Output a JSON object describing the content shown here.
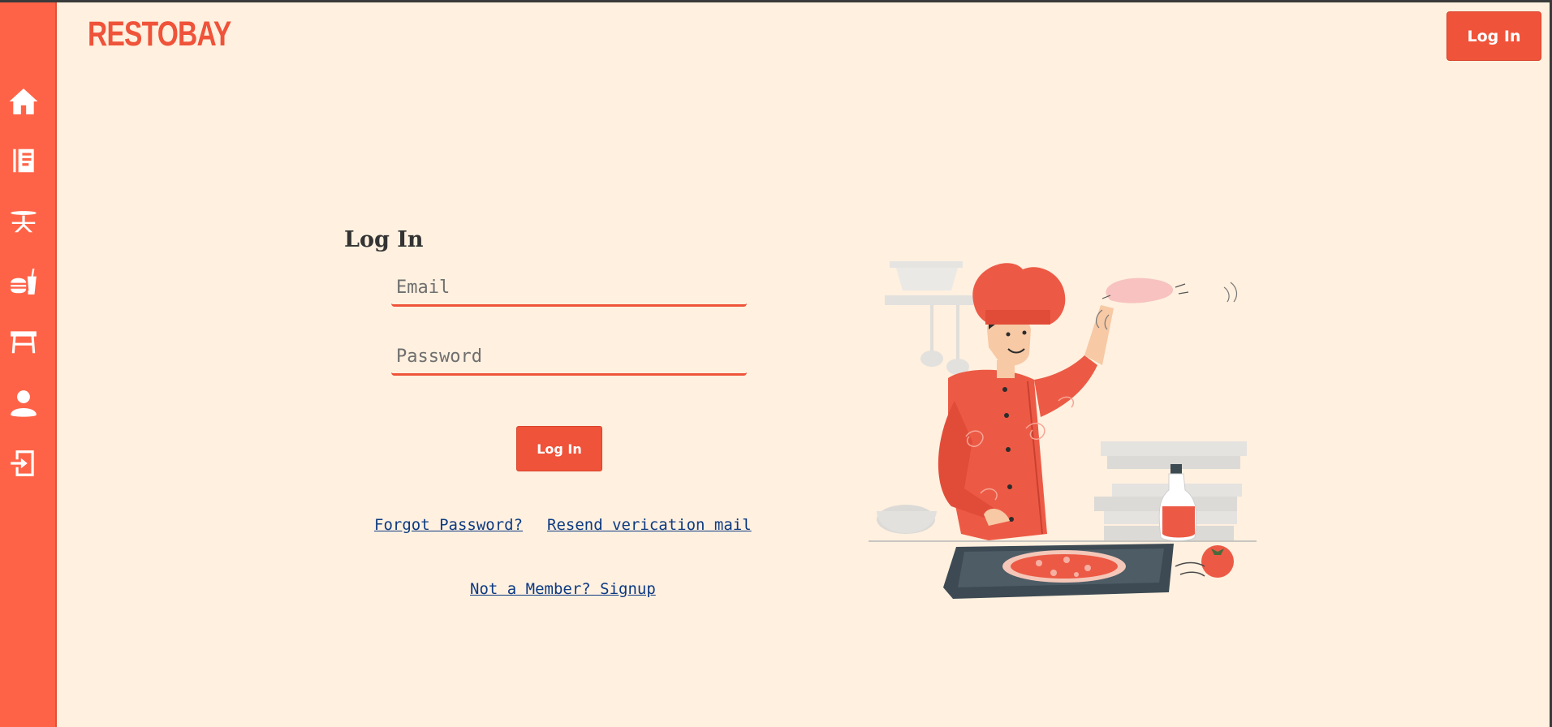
{
  "brand": {
    "name": "RESTOBAY"
  },
  "header": {
    "login_label": "Log In"
  },
  "sidebar": {
    "items": [
      {
        "icon": "home-icon"
      },
      {
        "icon": "menu-book-icon"
      },
      {
        "icon": "table-icon"
      },
      {
        "icon": "food-icon"
      },
      {
        "icon": "bench-icon"
      },
      {
        "icon": "user-icon"
      },
      {
        "icon": "sign-in-icon"
      }
    ]
  },
  "login_form": {
    "title": "Log In",
    "email": {
      "placeholder": "Email",
      "value": ""
    },
    "password": {
      "placeholder": "Password",
      "value": ""
    },
    "submit_label": "Log In",
    "forgot_password": "Forgot Password?",
    "resend_verification": "Resend verication mail",
    "signup": "Not a Member? Signup"
  },
  "colors": {
    "accent": "#ef533a",
    "sidebar": "#ff6347",
    "background": "#fff0df",
    "link": "#0d3a82"
  }
}
